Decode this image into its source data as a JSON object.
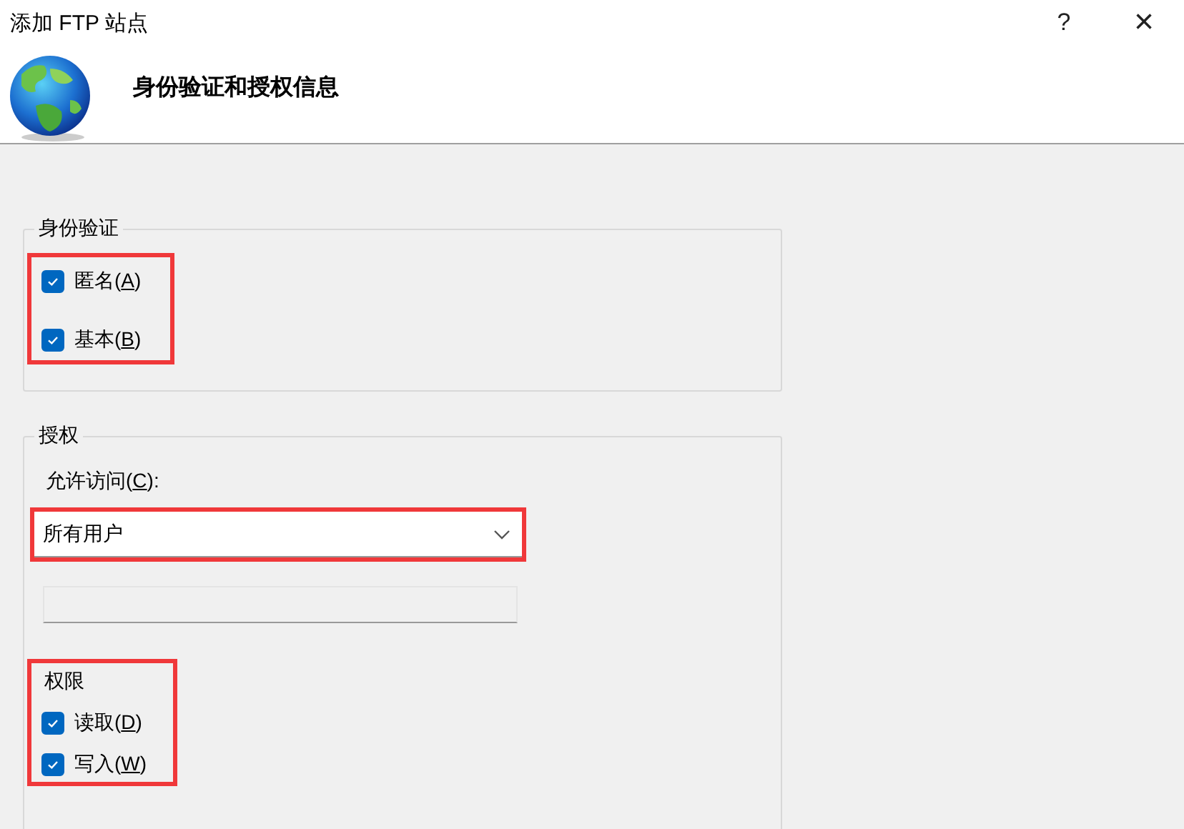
{
  "window": {
    "title": "添加 FTP 站点",
    "help_button": "?",
    "close_button": "×"
  },
  "header": {
    "heading": "身份验证和授权信息"
  },
  "authentication": {
    "legend": "身份验证",
    "highlighted": true,
    "options": [
      {
        "before": "匿名(",
        "key": "A",
        "after": ")",
        "checked": true
      },
      {
        "before": "基本(",
        "key": "B",
        "after": ")",
        "checked": true
      }
    ]
  },
  "authorization": {
    "legend": "授权",
    "access_label": {
      "before": "允许访问(",
      "key": "C",
      "after": "):"
    },
    "access_dropdown": {
      "value": "所有用户",
      "highlighted": true
    },
    "user_field": {
      "disabled": true
    },
    "permissions": {
      "heading": "权限",
      "highlighted": true,
      "options": [
        {
          "before": "读取(",
          "key": "D",
          "after": ")",
          "checked": true
        },
        {
          "before": "写入(",
          "key": "W",
          "after": ")",
          "checked": true
        }
      ]
    }
  }
}
